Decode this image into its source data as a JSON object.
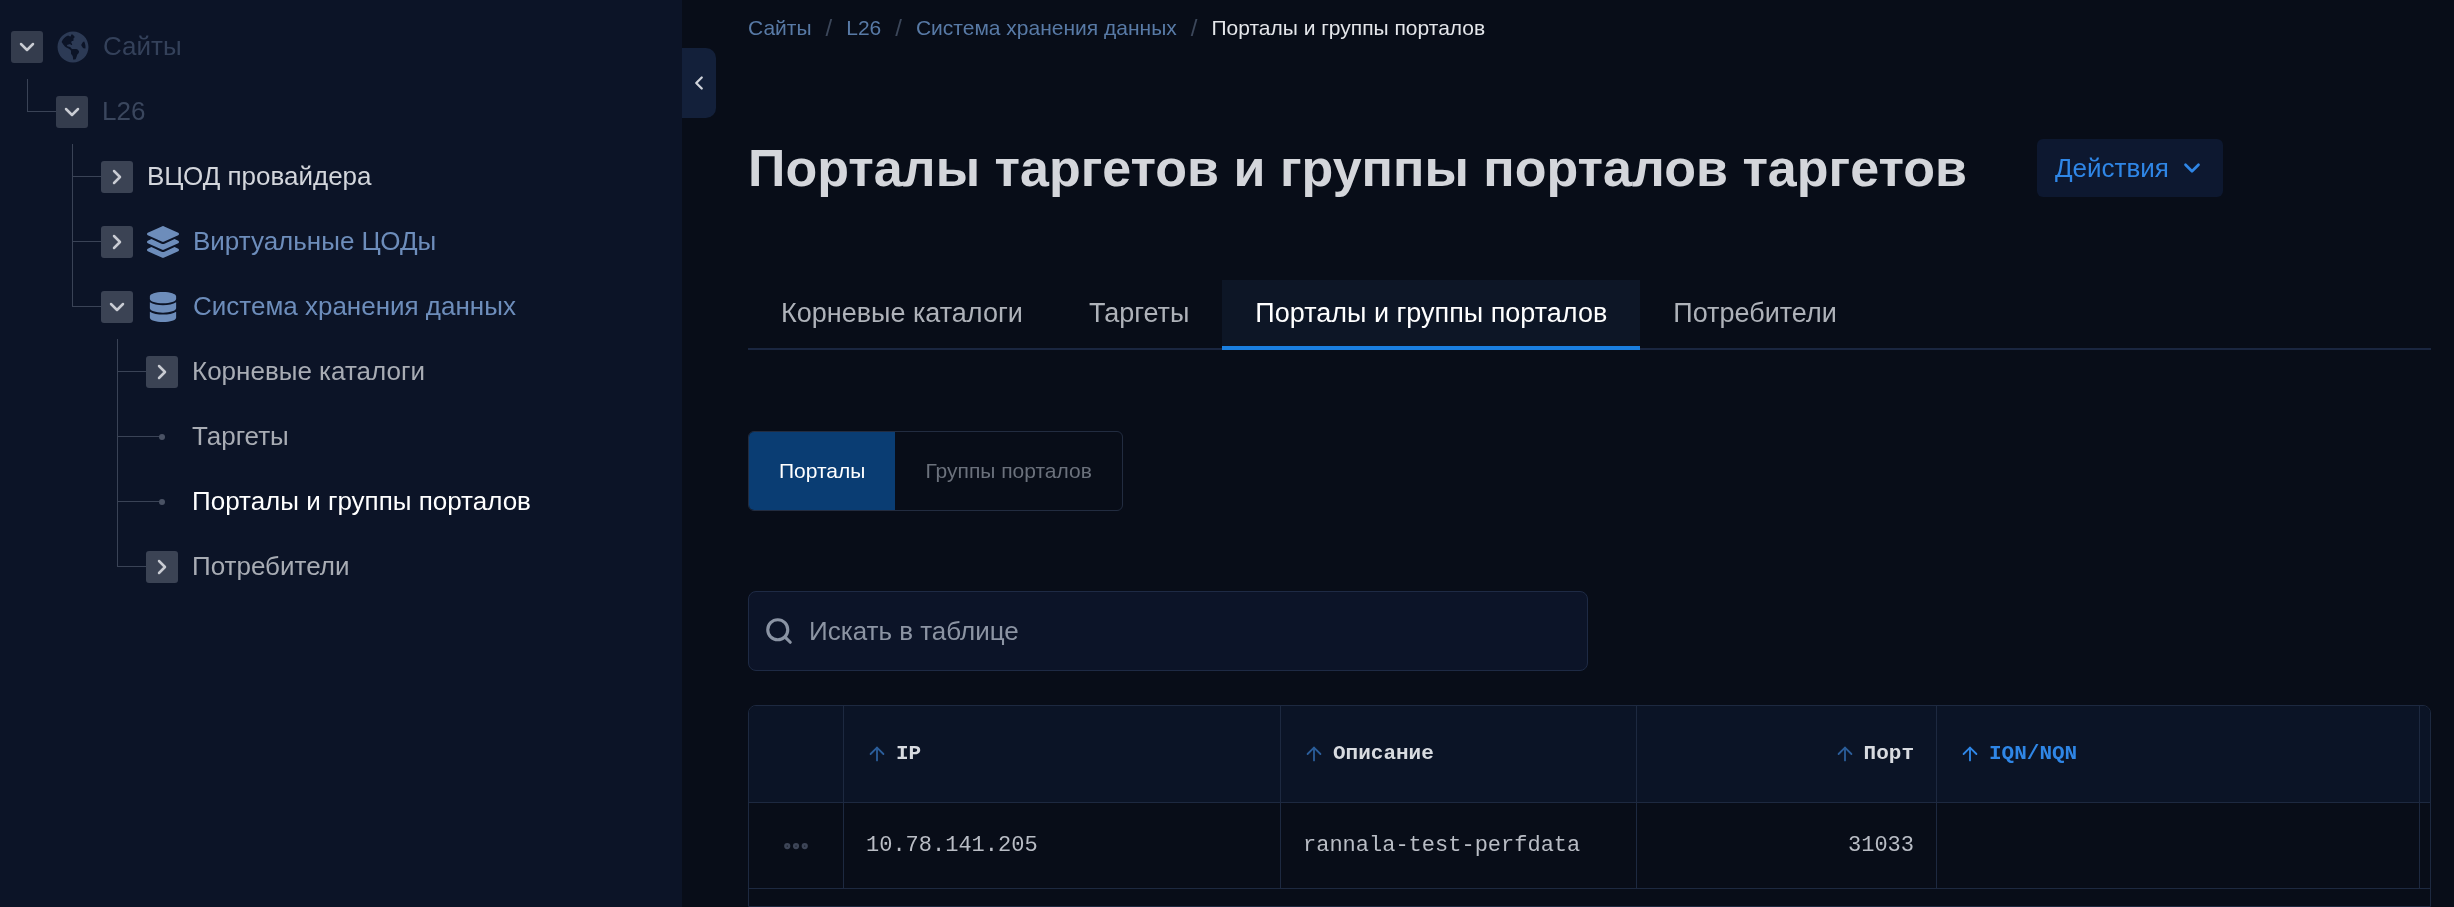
{
  "sidebar": {
    "tree": [
      {
        "label": "Сайты",
        "kind": "site",
        "expanded": true,
        "selected": false,
        "children": [
          {
            "label": "L26",
            "kind": "region",
            "expanded": true,
            "selected": false,
            "children": [
              {
                "label": "ВЦОД провайдера",
                "kind": "node",
                "expanded": false,
                "selected": false
              },
              {
                "label": "Виртуальные ЦОДы",
                "kind": "vdc",
                "expanded": false,
                "selected": false
              },
              {
                "label": "Система хранения данных",
                "kind": "storage",
                "expanded": true,
                "selected": false,
                "children": [
                  {
                    "label": "Корневые каталоги",
                    "kind": "child",
                    "expanded": false,
                    "selected": false
                  },
                  {
                    "label": "Таргеты",
                    "kind": "child",
                    "selected": false
                  },
                  {
                    "label": "Порталы и группы порталов",
                    "kind": "child",
                    "selected": true
                  },
                  {
                    "label": "Потребители",
                    "kind": "child",
                    "expanded": false,
                    "selected": false
                  }
                ]
              }
            ]
          }
        ]
      }
    ]
  },
  "breadcrumb": [
    {
      "label": "Сайты",
      "current": false
    },
    {
      "separator": "/",
      "label": "L26",
      "current": false
    },
    {
      "separator": "/",
      "label": "Система хранения данных",
      "current": false
    },
    {
      "separator": "/",
      "label": "Порталы и группы порталов",
      "current": true
    }
  ],
  "title": "Порталы таргетов и группы порталов таргетов",
  "actions_button": {
    "label": "Действия"
  },
  "tabs": [
    {
      "label": "Корневые каталоги",
      "selected": false
    },
    {
      "label": "Таргеты",
      "selected": false
    },
    {
      "label": "Порталы и группы порталов",
      "selected": true
    },
    {
      "label": "Потребители",
      "selected": false
    }
  ],
  "view_switch": [
    {
      "label": "Порталы",
      "selected": true
    },
    {
      "label": "Группы порталов",
      "selected": false
    }
  ],
  "search": {
    "placeholder": "Искать в таблице"
  },
  "table": {
    "columns": [
      {
        "label": "IP",
        "sorted": false
      },
      {
        "label": "Описание",
        "sorted": false
      },
      {
        "label": "Порт",
        "sorted": false
      },
      {
        "label": "IQN/NQN",
        "sorted": true
      }
    ],
    "rows": [
      {
        "cells": [
          "10.78.141.205",
          "rannala-test-perfdata",
          "31033"
        ]
      }
    ]
  }
}
